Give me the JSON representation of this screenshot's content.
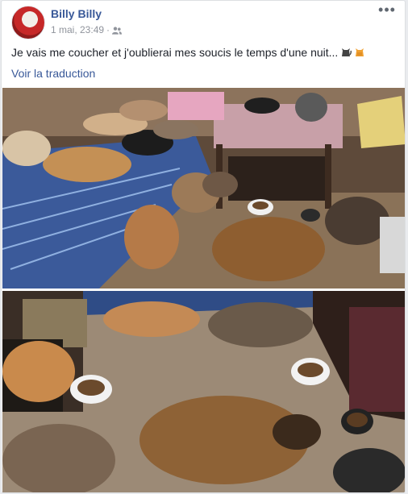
{
  "post": {
    "author": "Billy Billy",
    "timestamp": "1 mai, 23:49",
    "separator": "·",
    "audience_icon": "friends-icon",
    "more_icon": "more-options-icon",
    "text": "Je vais me coucher et j'oublierai mes soucis le temps d'une nuit...",
    "emojis": [
      "black-cat-emoji",
      "orange-cat-emoji"
    ],
    "translate_link": "Voir la traduction",
    "photos": [
      "dogs-on-bed-photo",
      "dogs-on-floor-photo"
    ]
  },
  "colors": {
    "link": "#385898",
    "text": "#1d2129",
    "meta": "#90949c",
    "page_bg": "#e9ebee"
  }
}
